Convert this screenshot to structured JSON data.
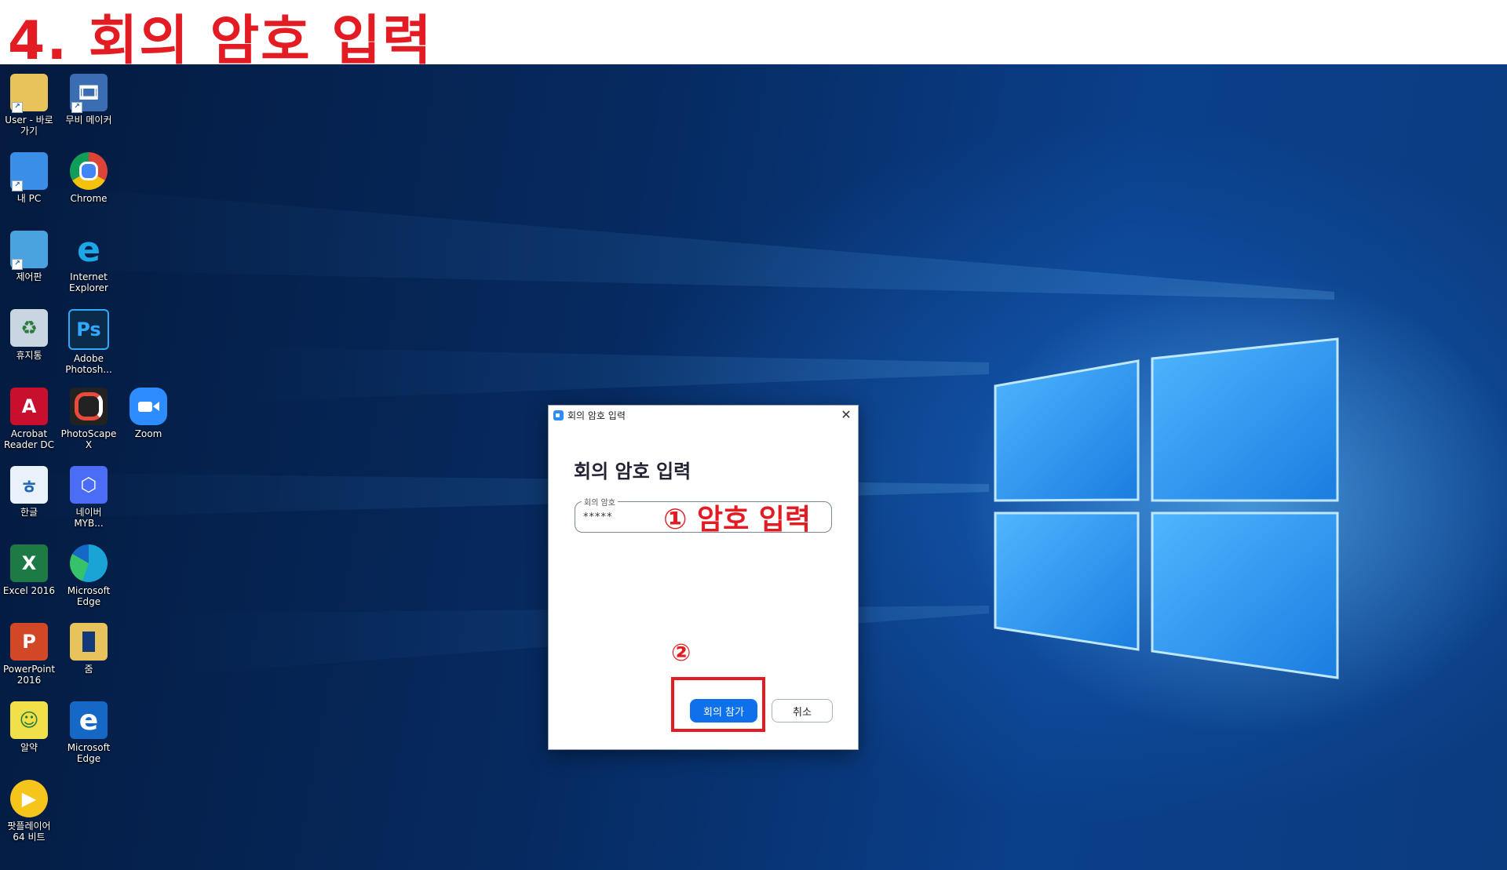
{
  "header": {
    "title": "4. 회의 암호 입력"
  },
  "desktop": {
    "icons": [
      {
        "label": "User - 바로 가기",
        "icon": "folder-icon",
        "glyph": "",
        "color": "#e8c25a"
      },
      {
        "label": "무비 메이커",
        "icon": "movie-maker-icon",
        "glyph": "",
        "color": "#3b6db3"
      },
      {
        "label": "내 PC",
        "icon": "computer-icon",
        "glyph": "",
        "color": "#3a8ee6"
      },
      {
        "label": "Chrome",
        "icon": "chrome-icon",
        "glyph": "",
        "color": "#ffffff"
      },
      {
        "label": "제어판",
        "icon": "control-panel-icon",
        "glyph": "",
        "color": "#4aa3df"
      },
      {
        "label": "Internet Explorer",
        "icon": "internet-explorer-icon",
        "glyph": "e",
        "color": "#1ea7e8"
      },
      {
        "label": "휴지통",
        "icon": "recycle-bin-icon",
        "glyph": "",
        "color": "#c9d6e2"
      },
      {
        "label": "Adobe Photosh...",
        "icon": "photoshop-icon",
        "glyph": "Ps",
        "color": "#0b2b4a"
      },
      {
        "label": "Acrobat Reader DC",
        "icon": "acrobat-icon",
        "glyph": "A",
        "color": "#c8102e"
      },
      {
        "label": "PhotoScape X",
        "icon": "photoscape-icon",
        "glyph": "",
        "color": "#222222"
      },
      {
        "label": "Zoom",
        "icon": "zoom-icon",
        "glyph": "",
        "color": "#2d8cff"
      },
      {
        "label": "한글",
        "icon": "hangul-icon",
        "glyph": "ㅎ",
        "color": "#e9f2fb"
      },
      {
        "label": "네이버 MYB...",
        "icon": "naver-mybox-icon",
        "glyph": "",
        "color": "#4b6cf5"
      },
      {
        "label": "Excel 2016",
        "icon": "excel-icon",
        "glyph": "X",
        "color": "#1d7a45"
      },
      {
        "label": "Microsoft Edge",
        "icon": "edge-icon",
        "glyph": "",
        "color": "#1aa4d6"
      },
      {
        "label": "PowerPoint 2016",
        "icon": "powerpoint-icon",
        "glyph": "P",
        "color": "#d24726"
      },
      {
        "label": "줌",
        "icon": "zoom-folder-icon",
        "glyph": "",
        "color": "#e8c25a"
      },
      {
        "label": "알약",
        "icon": "alyac-icon",
        "glyph": "",
        "color": "#f2e04a"
      },
      {
        "label": "Microsoft Edge",
        "icon": "edge-legacy-icon",
        "glyph": "e",
        "color": "#1668c6"
      },
      {
        "label": "팟플레이어 64 비트",
        "icon": "potplayer-icon",
        "glyph": "▶",
        "color": "#f6c51b"
      }
    ]
  },
  "dialog": {
    "window_title": "회의 암호 입력",
    "heading": "회의 암호 입력",
    "password_label": "회의 암호",
    "password_value": "*****",
    "join_button": "회의 참가",
    "cancel_button": "취소",
    "close_symbol": "✕"
  },
  "annotations": {
    "step1": "① 암호 입력",
    "step2": "②"
  },
  "colors": {
    "annotation": "#e31c23",
    "primary_button": "#0e71eb",
    "zoom_brand": "#2d8cff"
  }
}
